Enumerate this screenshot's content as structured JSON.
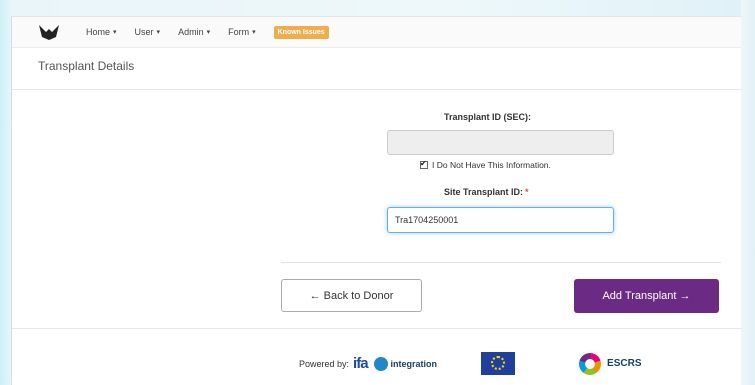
{
  "nav": {
    "home": "Home",
    "user": "User",
    "admin": "Admin",
    "form": "Form",
    "known_issues": "Known Issues"
  },
  "page": {
    "title": "Transplant Details"
  },
  "form": {
    "transplant_id_label": "Transplant ID (SEC):",
    "transplant_id_value": "",
    "no_info_label": "I Do Not Have This Information.",
    "no_info_checked": true,
    "site_id_label": "Site Transplant ID:",
    "required_mark": "*",
    "site_id_value": "Tra1704250001"
  },
  "buttons": {
    "back": "← Back to Donor",
    "add": "Add Transplant →"
  },
  "footer": {
    "powered_by": "Powered by:",
    "ifa": "ifa",
    "integration": "integration",
    "escrs": "ESCRS"
  },
  "colors": {
    "primary_button": "#6b2a83",
    "badge": "#f0ad4e",
    "required": "#d9534f"
  }
}
